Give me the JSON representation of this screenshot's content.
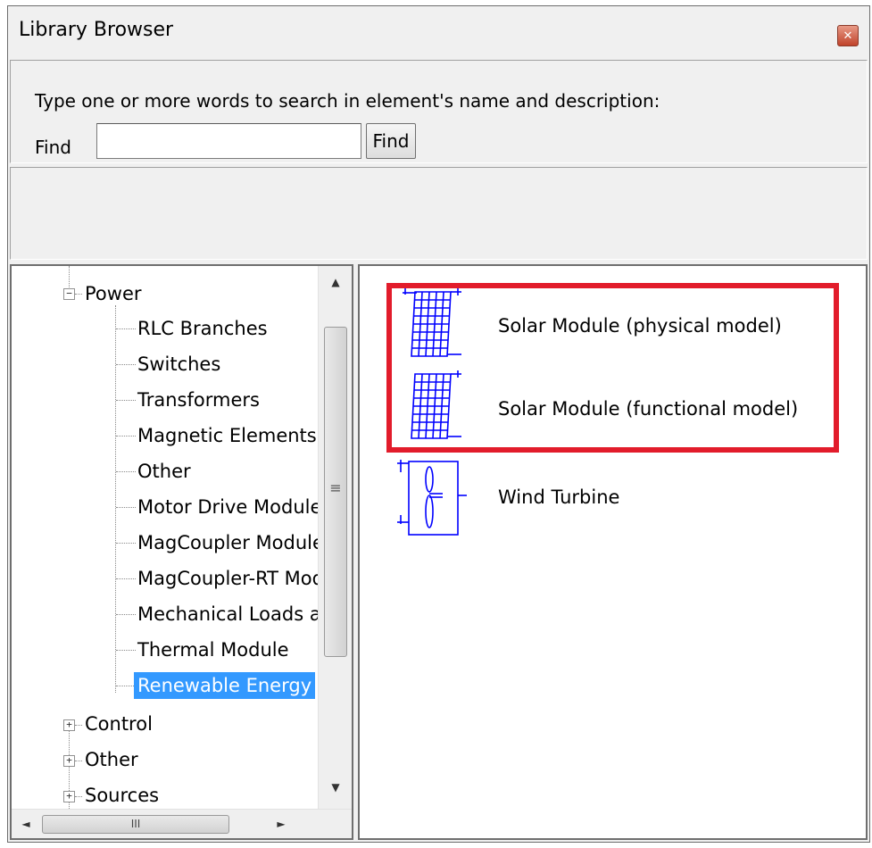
{
  "window": {
    "title": "Library Browser",
    "close_icon": "close-icon"
  },
  "search": {
    "instruction": "Type one or more words to search in element's name and  description:",
    "find_label": "Find",
    "input_value": "",
    "button_label": "Find"
  },
  "tree": {
    "power": {
      "label": "Power",
      "expander": "−"
    },
    "children": [
      "RLC Branches",
      "Switches",
      "Transformers",
      "Magnetic Elements",
      "Other",
      "Motor Drive Module",
      "MagCoupler Module",
      "MagCoupler-RT Module",
      "Mechanical Loads and Sensors",
      "Thermal Module",
      "Renewable Energy"
    ],
    "selected": "Renewable Energy",
    "siblings": [
      {
        "label": "Control",
        "expander": "+"
      },
      {
        "label": "Other",
        "expander": "+"
      },
      {
        "label": "Sources",
        "expander": "+"
      }
    ],
    "scrollbar": {
      "up_icon": "▲",
      "down_icon": "▼",
      "left_icon": "◄",
      "right_icon": "►",
      "thumb_grip": "≡",
      "hthumb_grip": "III"
    }
  },
  "elements": [
    {
      "name": "Solar Module (physical model)",
      "icon": "solar-module-icon"
    },
    {
      "name": "Solar Module (functional model)",
      "icon": "solar-module-icon"
    },
    {
      "name": "Wind Turbine",
      "icon": "wind-turbine-icon"
    }
  ],
  "colors": {
    "highlight": "#e21c2b",
    "selection": "#3399ff",
    "icon_stroke": "#0000ff"
  }
}
